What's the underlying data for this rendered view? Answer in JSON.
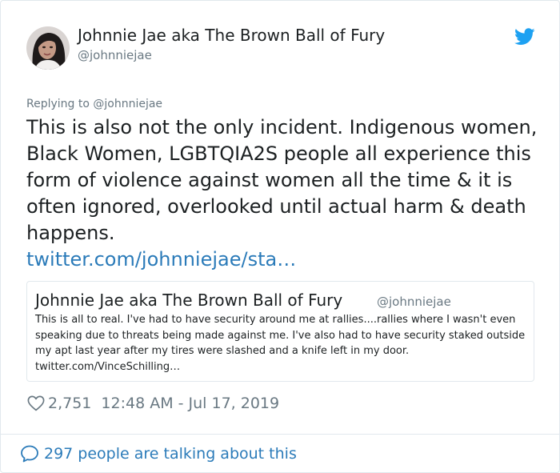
{
  "author": {
    "name": "Johnnie Jae aka The Brown Ball of Fury",
    "handle": "@johnniejae"
  },
  "icons": {
    "brand": "twitter-bird-icon",
    "like": "heart-icon",
    "conversation": "speech-bubble-icon"
  },
  "colors": {
    "link": "#2b7bb9",
    "twitter_blue": "#1da1f2",
    "muted": "#697882",
    "border": "#e1e8ed"
  },
  "reply": {
    "prefix": "Replying to",
    "mention": "@johnniejae"
  },
  "tweet": {
    "text": "This is also not the only incident. Indigenous women, Black Women, LGBTQIA2S people all experience this form of violence against women all the time & it is often ignored, overlooked until actual harm & death happens.",
    "link": "twitter.com/johnniejae/sta…"
  },
  "quoted": {
    "name": "Johnnie Jae aka The Brown Ball of Fury",
    "handle": "@johnniejae",
    "text": "This is all to real. I've had to have security around me at rallies....rallies where I wasn't even speaking due to threats being made against me. I've also had to have security staked outside my apt last year after my tires were slashed and a knife left in my door. twitter.com/VinceSchilling…"
  },
  "meta": {
    "likes": "2,751",
    "timestamp": "12:48 AM - Jul 17, 2019"
  },
  "footer": {
    "talking": "297 people are talking about this"
  }
}
